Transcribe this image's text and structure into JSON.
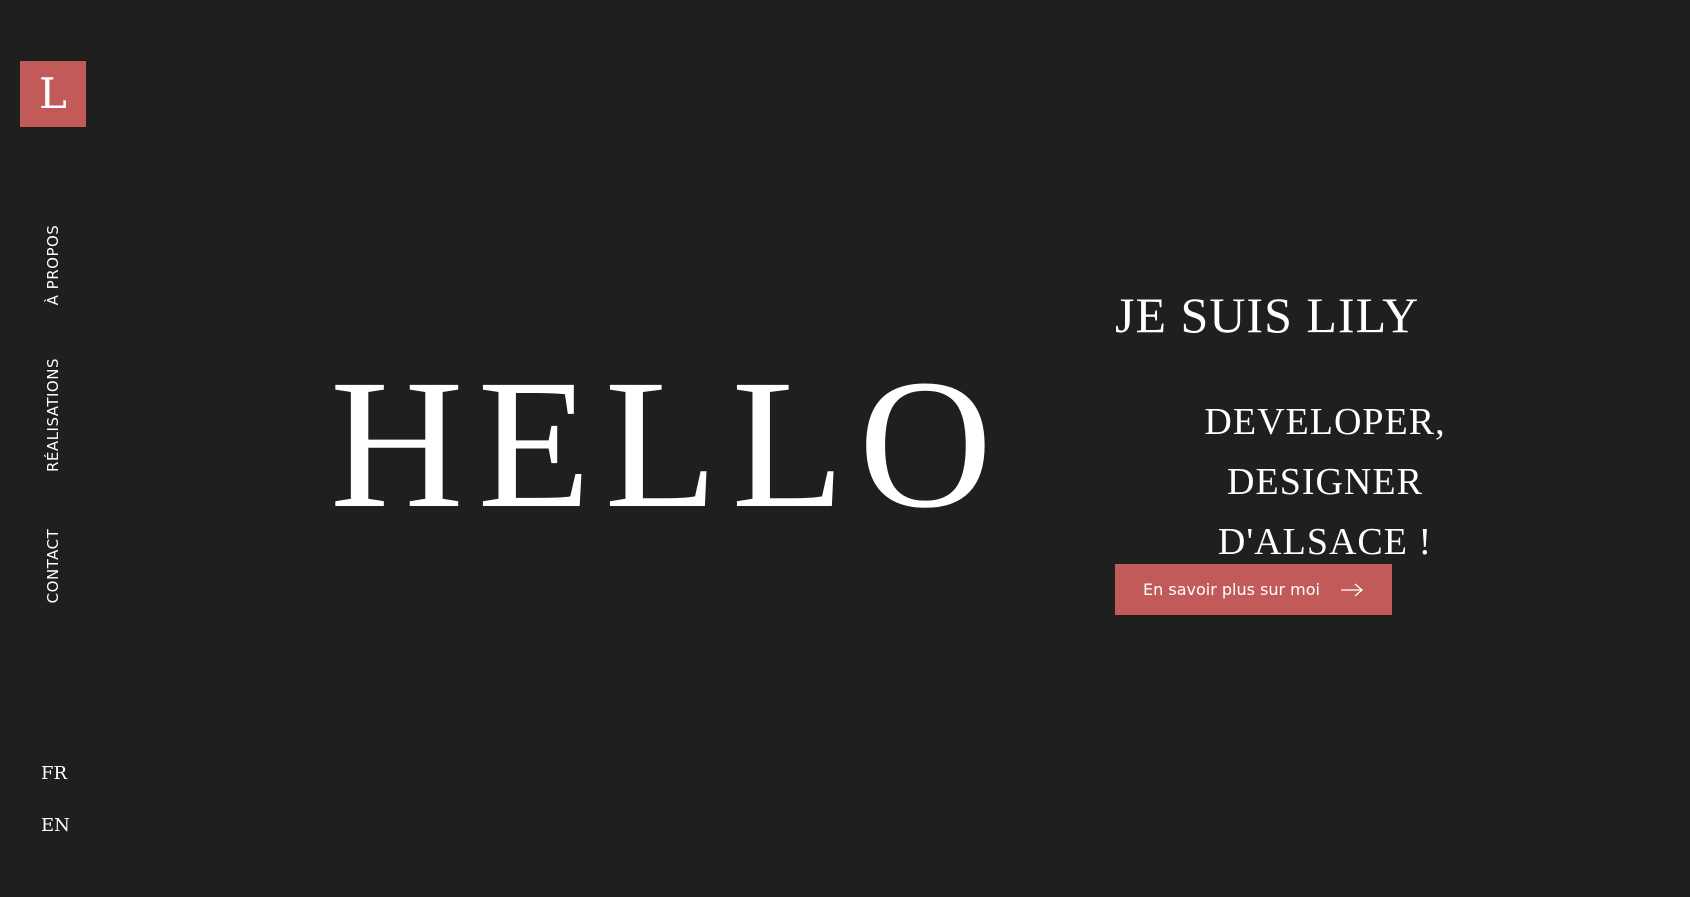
{
  "logo": {
    "letter": "L"
  },
  "nav": {
    "items": [
      {
        "label": "À PROPOS"
      },
      {
        "label": "RÉALISATIONS"
      },
      {
        "label": "CONTACT"
      }
    ]
  },
  "languages": [
    {
      "label": "FR"
    },
    {
      "label": "EN"
    }
  ],
  "hero": {
    "hello": "HELLO",
    "name": "JE SUIS LILY",
    "role_line1": "DEVELOPER, DESIGNER",
    "role_line2": "D'ALSACE !",
    "cta_label": "En savoir plus sur moi",
    "cta_icon": "arrow-right-icon"
  },
  "colors": {
    "background": "#1f1f1f",
    "accent": "#c35a5a",
    "text": "#ffffff"
  }
}
